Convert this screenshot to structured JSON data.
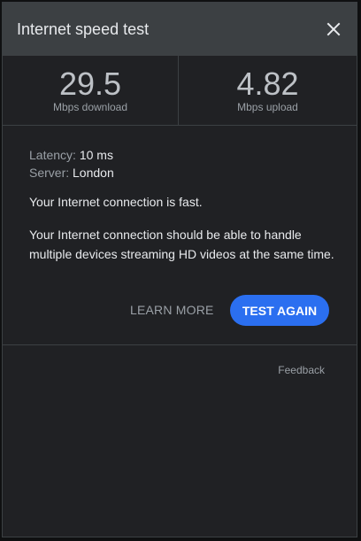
{
  "dialog": {
    "title": "Internet speed test",
    "close_icon": "close-icon"
  },
  "results": {
    "download": {
      "value": "29.5",
      "unit": "Mbps download"
    },
    "upload": {
      "value": "4.82",
      "unit": "Mbps upload"
    }
  },
  "details": {
    "latency_label": "Latency:",
    "latency_value": "10 ms",
    "server_label": "Server:",
    "server_value": "London"
  },
  "summary": "Your Internet connection is fast.",
  "description": "Your Internet connection should be able to handle multiple devices streaming HD videos at the same time.",
  "actions": {
    "learn_more": "LEARN MORE",
    "test_again": "TEST AGAIN"
  },
  "footer": {
    "feedback": "Feedback"
  },
  "colors": {
    "accent": "#2b6ff0",
    "header_bg": "#3c4043",
    "panel_bg": "#202124"
  }
}
